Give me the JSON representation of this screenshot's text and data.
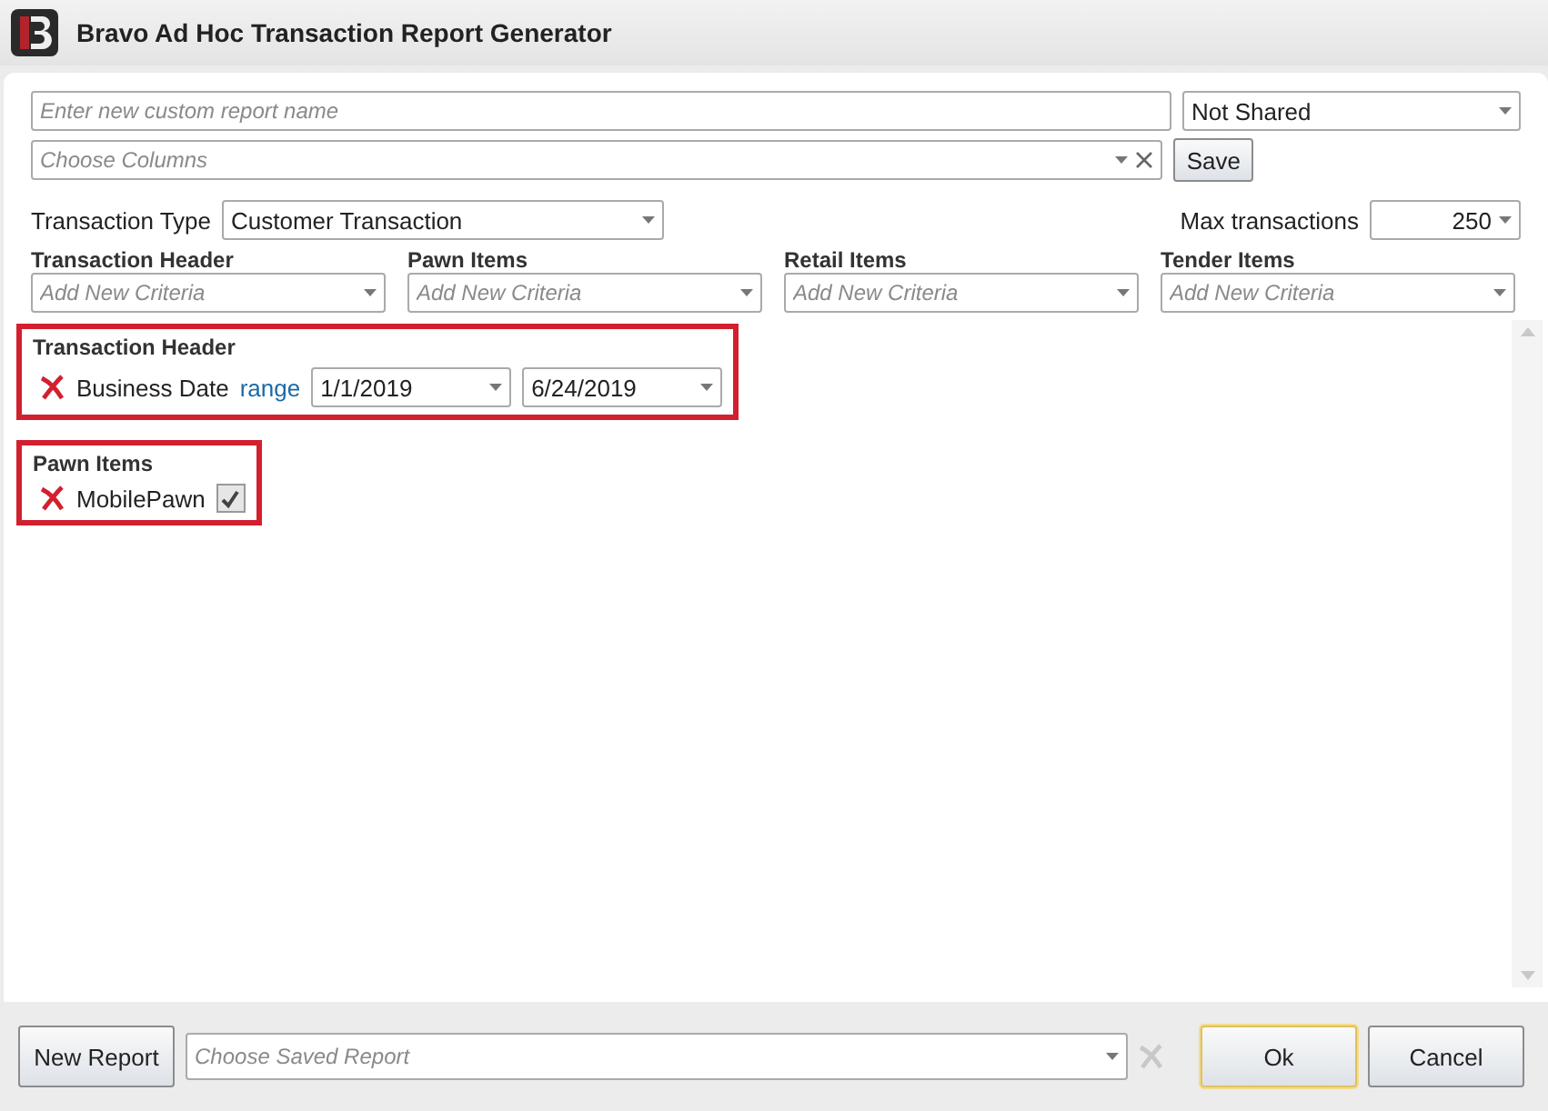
{
  "window": {
    "title": "Bravo Ad Hoc Transaction Report Generator"
  },
  "report_name": {
    "placeholder": "Enter new custom report name"
  },
  "sharing": {
    "value": "Not Shared"
  },
  "columns": {
    "placeholder": "Choose Columns"
  },
  "save_button": "Save",
  "transaction_type": {
    "label": "Transaction Type",
    "value": "Customer Transaction"
  },
  "max_transactions": {
    "label": "Max transactions",
    "value": "250"
  },
  "criteria_pickers": [
    {
      "label": "Transaction Header",
      "placeholder": "Add New Criteria"
    },
    {
      "label": "Pawn Items",
      "placeholder": "Add New Criteria"
    },
    {
      "label": "Retail Items",
      "placeholder": "Add New Criteria"
    },
    {
      "label": "Tender Items",
      "placeholder": "Add New Criteria"
    }
  ],
  "criteria_groups": [
    {
      "title": "Transaction Header",
      "items": [
        {
          "kind": "range",
          "label": "Business Date",
          "link": "range",
          "from": "1/1/2019",
          "to": "6/24/2019"
        }
      ]
    },
    {
      "title": "Pawn Items",
      "items": [
        {
          "kind": "checkbox",
          "label": "MobilePawn",
          "checked": true
        }
      ]
    }
  ],
  "footer": {
    "new_report": "New Report",
    "saved_report": {
      "placeholder": "Choose Saved Report"
    },
    "ok": "Ok",
    "cancel": "Cancel"
  }
}
